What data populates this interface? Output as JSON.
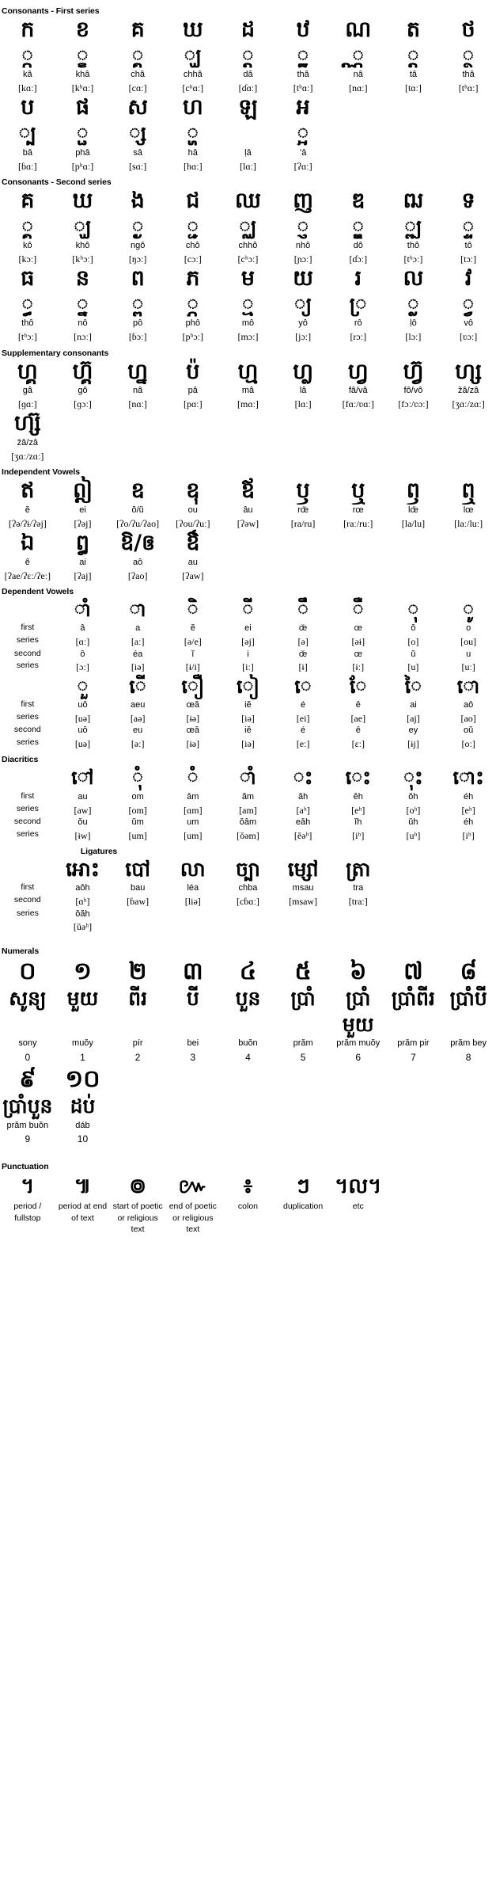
{
  "sections": {
    "consonants_first": {
      "title": "Consonants - First series",
      "row1": {
        "letters": [
          "ក",
          "ខ",
          "គ",
          "ឃ",
          "ដ",
          "ឋ",
          "ណ",
          "ត",
          "ថ"
        ],
        "subscripts": [
          "្ក",
          "្ខ",
          "្គ",
          "្ឃ",
          "្ដ",
          "្ឋ",
          "្ណ",
          "្ត",
          "្ថ"
        ],
        "rom": [
          "kâ",
          "khâ",
          "châ",
          "chhâ",
          "dâ",
          "thâ",
          "nâ",
          "tâ",
          "thâ"
        ],
        "ipa": [
          "[kɑː]",
          "[kʰɑː]",
          "[cɑː]",
          "[cʰɑː]",
          "[ɗɑː]",
          "[tʰɑː]",
          "[nɑː]",
          "[tɑː]",
          "[tʰɑː]"
        ]
      },
      "row2": {
        "letters": [
          "ប",
          "ផ",
          "ស",
          "ហ",
          "ឡ",
          "អ"
        ],
        "subscripts": [
          "្ប",
          "្ផ",
          "្ស",
          "្ហ",
          "",
          "្អ"
        ],
        "rom": [
          "bâ",
          "phâ",
          "sâ",
          "hâ",
          "ḷâ",
          "’â"
        ],
        "ipa": [
          "[ɓɑː]",
          "[pʰɑː]",
          "[sɑː]",
          "[hɑː]",
          "[lɑː]",
          "[ʔɑː]"
        ]
      }
    },
    "consonants_second": {
      "title": "Consonants - Second series",
      "row1": {
        "letters": [
          "គ",
          "ឃ",
          "ង",
          "ជ",
          "ឈ",
          "ញ",
          "ឌ",
          "ឍ",
          "ទ"
        ],
        "subscripts": [
          "្គ",
          "្ឃ",
          "្ង",
          "្ជ",
          "្ឈ",
          "្ញ",
          "្ឌ",
          "្ឍ",
          "្ទ"
        ],
        "rom": [
          "kô",
          "khô",
          "ngô",
          "chô",
          "chhô",
          "nhô",
          "dô",
          "thô",
          "tô"
        ],
        "ipa": [
          "[kɔː]",
          "[kʰɔː]",
          "[ŋɔː]",
          "[cɔː]",
          "[cʰɔː]",
          "[ɲɔː]",
          "[ɗɔː]",
          "[tʰɔː]",
          "[tɔː]"
        ]
      },
      "row2": {
        "letters": [
          "ធ",
          "ន",
          "ព",
          "ភ",
          "ម",
          "យ",
          "រ",
          "ល",
          "វ"
        ],
        "subscripts": [
          "្ធ",
          "្ន",
          "្ព",
          "្ភ",
          "្ម",
          "្យ",
          "្រ",
          "្ល",
          "្វ"
        ],
        "rom": [
          "thô",
          "nô",
          "pô",
          "phô",
          "mô",
          "yô",
          "rô",
          "ḷô",
          "vô"
        ],
        "ipa": [
          "[tʰɔː]",
          "[nɔː]",
          "[ɓɔː]",
          "[pʰɔː]",
          "[mɔː]",
          "[jɔː]",
          "[rɔː]",
          "[lɔː]",
          "[ʋɔː]"
        ]
      }
    },
    "supplementary": {
      "title": "Supplementary consonants",
      "row1": {
        "letters": [
          "ហ្គ",
          "ហ្គ៊",
          "ហ្ន",
          "ប៉",
          "ហ្ម",
          "ហ្ល",
          "ហ្វ",
          "ហ្វ៊",
          "ហ្ស"
        ],
        "rom": [
          "gâ",
          "gô",
          "nâ",
          "pâ",
          "mâ",
          "lâ",
          "fâ/vâ",
          "fô/vô",
          "žâ/zâ"
        ],
        "ipa": [
          "[ɡɑː]",
          "[ɡɔː]",
          "[nɑː]",
          "[pɑː]",
          "[mɑː]",
          "[lɑː]",
          "[fɑː/ʋɑː]",
          "[fɔː/ʋɔː]",
          "[ʒɑː/zɑː]"
        ]
      },
      "row2": {
        "letters": [
          "ហ្ស៊"
        ],
        "rom": [
          "žâ/zâ"
        ],
        "ipa": [
          "[ʒɑː/zɑː]"
        ]
      }
    },
    "independent_vowels": {
      "title": "Independent Vowels",
      "row1": {
        "letters": [
          "ឥ",
          "ឦ",
          "ឧ",
          "ឧុ",
          "ឪ",
          "ឫ",
          "ឬ",
          "ឭ",
          "ឮ"
        ],
        "rom": [
          "ĕ",
          "ei",
          "ŏ/ŭ",
          "ou",
          "âu",
          "rœ̆",
          "rœ",
          "lœ̆",
          "lœ"
        ],
        "ipa": [
          "[ʔə/ʔɨ/ʔəj]",
          "[ʔəj]",
          "[ʔo/ʔu/ʔao]",
          "[ʔou/ʔuː]",
          "[ʔəw]",
          "[ra/ru]",
          "[raː/ruː]",
          "[la/lu]",
          "[laː/luː]"
        ]
      },
      "row2": {
        "letters": [
          "ឯ",
          "ឰ",
          "ឱ/ឲ",
          "ឳ"
        ],
        "rom": [
          "ê",
          "ai",
          "aô",
          "au"
        ],
        "ipa": [
          "[ʔae/ʔɛː/ʔeː]",
          "[ʔaj]",
          "[ʔao]",
          "[ʔaw]"
        ]
      }
    },
    "dependent_vowels": {
      "title": "Dependent Vowels",
      "labels": {
        "first": "first",
        "second": "second",
        "series": "series"
      },
      "row1": {
        "glyphs": [
          "ាំ",
          "ា",
          "ិ",
          "ី",
          "ឹ",
          "ឺ",
          "ុ",
          "ូ"
        ],
        "first_rom": [
          "â",
          "a",
          "ĕ",
          "ei",
          "œ̆",
          "œ",
          "ŏ",
          "o"
        ],
        "first_ipa": [
          "[ɑː]",
          "[aː]",
          "[ə/e]",
          "[əj]",
          "[ə]",
          "[əɨ]",
          "[o]",
          "[ou]"
        ],
        "second_rom": [
          "ô",
          "éa",
          "ĭ",
          "i",
          "œ̆",
          "œ",
          "ŭ",
          "u"
        ],
        "second_ipa": [
          "[ɔː]",
          "[iə]",
          "[ɨ/i]",
          "[iː]",
          "[ɨ]",
          "[ɨː]",
          "[u]",
          "[uː]"
        ]
      },
      "row2": {
        "glyphs": [
          "ួ",
          "ើ",
          "ឿ",
          "ៀ",
          "េ",
          "ែ",
          "ៃ",
          "ោ"
        ],
        "first_rom": [
          "uŏ",
          "aeu",
          "œă",
          "iĕ",
          "é",
          "ê",
          "ai",
          "aô"
        ],
        "first_ipa": [
          "[uə]",
          "[aə]",
          "[ɨə]",
          "[iə]",
          "[ei]",
          "[ae]",
          "[aj]",
          "[ao]"
        ],
        "second_rom": [
          "uŏ",
          "eu",
          "œă",
          "iĕ",
          "é",
          "ê",
          "ey",
          "oŭ"
        ],
        "second_ipa": [
          "[uə]",
          "[əː]",
          "[ɨə]",
          "[iə]",
          "[eː]",
          "[ɛː]",
          "[ɨj]",
          "[oː]"
        ]
      }
    },
    "diacritics": {
      "title": "Diacritics",
      "labels": {
        "first": "first",
        "second": "second",
        "series": "series"
      },
      "row1": {
        "glyphs": [
          "ៅ",
          "ុំ",
          "ំ",
          "ាំ",
          "ះ",
          "េះ",
          "ុះ",
          "ោះ"
        ],
        "first_rom": [
          "au",
          "om",
          "âm",
          "ăm",
          "ăh",
          "ĕh",
          "ŏh",
          "éh"
        ],
        "first_ipa": [
          "[aw]",
          "[om]",
          "[ɑm]",
          "[am]",
          "[aʰ]",
          "[eʰ]",
          "[oʰ]",
          "[eʰ]"
        ],
        "second_rom": [
          "ŏu",
          "ŭm",
          "um",
          "ŏâm",
          "eăh",
          "ĭh",
          "ŭh",
          "éh"
        ],
        "second_ipa": [
          "[ɨw]",
          "[um]",
          "[um]",
          "[ŏəm]",
          "[ĕəʰ]",
          "[iʰ]",
          "[uʰ]",
          "[iʰ]"
        ]
      }
    },
    "ligatures": {
      "title": "Ligatures",
      "labels": {
        "first": "first",
        "second": "second",
        "series": "series"
      },
      "row1": {
        "glyphs": [
          "អោះ",
          "បៅ",
          "លា",
          "ច្បា",
          "ម្សៅ",
          "ត្រា"
        ],
        "first_rom": [
          "aôh",
          "bau",
          "léa",
          "chba",
          "msau",
          "tra"
        ],
        "first_ipa": [
          "[ɑʰ]",
          "[ɓaw]",
          "[liə]",
          "[cɓɑː]",
          "[msaw]",
          "[traː]"
        ],
        "second_rom": [
          "ŏăh"
        ],
        "second_ipa": [
          "[ŭəʰ]"
        ]
      }
    },
    "numerals": {
      "title": "Numerals",
      "row1": {
        "glyphs": [
          "០",
          "១",
          "២",
          "៣",
          "៤",
          "៥",
          "៦",
          "៧",
          "៨"
        ],
        "khmer_words": [
          "សូន្យ",
          "មួយ",
          "ពីរ",
          "បី",
          "បួន",
          "ប្រាំ",
          "ប្រាំមួយ",
          "ប្រាំពីរ",
          "ប្រាំបី"
        ],
        "rom": [
          "sony",
          "muŏy",
          "pír",
          "bei",
          "buŏn",
          "prăm",
          "prăm muŏy",
          "prăm pir",
          "prăm bey"
        ],
        "digits": [
          "0",
          "1",
          "2",
          "3",
          "4",
          "5",
          "6",
          "7",
          "8"
        ]
      },
      "row2": {
        "glyphs": [
          "៩",
          "១០"
        ],
        "khmer_words": [
          "ប្រាំបួន",
          "ដប់"
        ],
        "rom": [
          "prăm buŏn",
          "dáb"
        ],
        "digits": [
          "9",
          "10"
        ]
      }
    },
    "punctuation": {
      "title": "Punctuation",
      "glyphs": [
        "។",
        "៕",
        "៙",
        "៚",
        "៖",
        "ៗ",
        "។ល។"
      ],
      "labels": [
        "period / fullstop",
        "period at end of text",
        "start of poetic or religious text",
        "end of poetic or religious text",
        "colon",
        "duplication",
        "etc"
      ]
    }
  }
}
